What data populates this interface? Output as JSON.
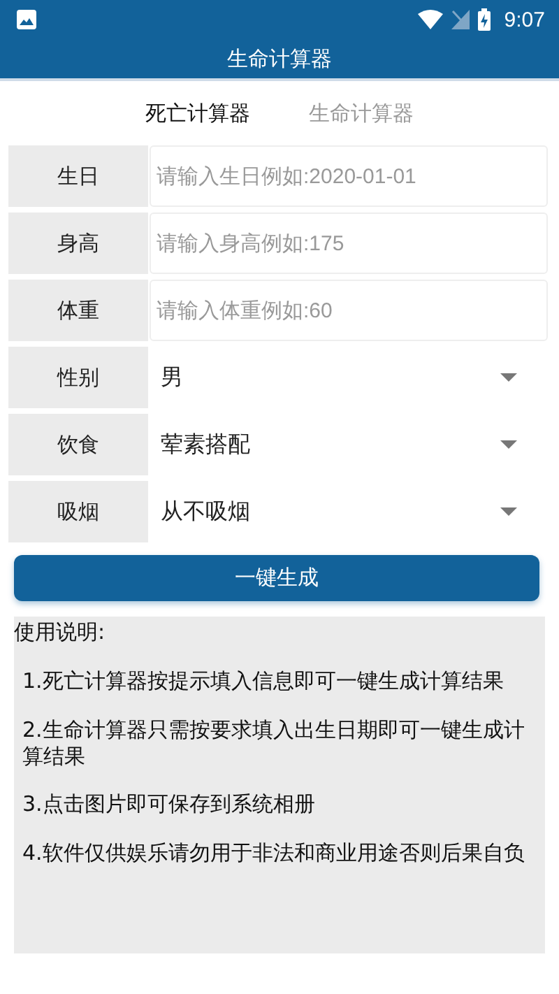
{
  "status_bar": {
    "time": "9:07"
  },
  "app_bar": {
    "title": "生命计算器"
  },
  "tabs": [
    {
      "label": "死亡计算器",
      "selected": true
    },
    {
      "label": "生命计算器",
      "selected": false
    }
  ],
  "form": [
    {
      "kind": "input",
      "label": "生日",
      "placeholder": "请输入生日例如:2020-01-01"
    },
    {
      "kind": "input",
      "label": "身高",
      "placeholder": "请输入身高例如:175"
    },
    {
      "kind": "input",
      "label": "体重",
      "placeholder": "请输入体重例如:60"
    },
    {
      "kind": "select",
      "label": "性别",
      "value": "男"
    },
    {
      "kind": "select",
      "label": "饮食",
      "value": "荤素搭配"
    },
    {
      "kind": "select",
      "label": "吸烟",
      "value": "从不吸烟"
    }
  ],
  "generate_button": "一键生成",
  "instructions": {
    "heading": "使用说明:",
    "items": [
      "1.死亡计算器按提示填入信息即可一键生成计算结果",
      "2.生命计算器只需按要求填入出生日期即可一键生成计算结果",
      "3.点击图片即可保存到系统相册",
      "4.软件仅供娱乐请勿用于非法和商业用途否则后果自负"
    ]
  }
}
